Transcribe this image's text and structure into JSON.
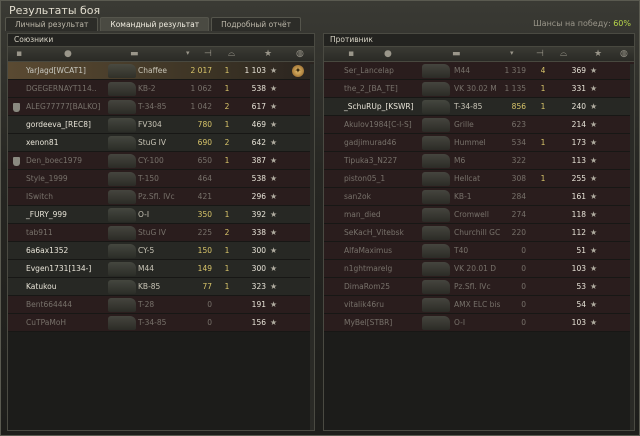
{
  "window": {
    "title": "Результаты боя"
  },
  "tabs": [
    {
      "label": "Личный результат",
      "active": false
    },
    {
      "label": "Командный результат",
      "active": true
    },
    {
      "label": "Подробный отчёт",
      "active": false
    }
  ],
  "chance": {
    "label": "Шансы на победу:",
    "value": "60%"
  },
  "allies": {
    "title": "Союзники",
    "rows": [
      {
        "name": "YarJagd[WCAT1]",
        "tank": "Chaffee",
        "damage": "2 017",
        "kills": "1",
        "xp": "1 103",
        "state": "self",
        "clan": false,
        "medal": true
      },
      {
        "name": "DGEGERNAYT114..",
        "tank": "KB-2",
        "damage": "1 062",
        "kills": "1",
        "xp": "538",
        "state": "dead",
        "clan": false
      },
      {
        "name": "ALEG77777[BALKO]",
        "tank": "T-34-85",
        "damage": "1 042",
        "kills": "2",
        "xp": "617",
        "state": "dead",
        "clan": true
      },
      {
        "name": "gordeeva_[REC8]",
        "tank": "FV304",
        "damage": "780",
        "kills": "1",
        "xp": "469",
        "state": "alive",
        "clan": false
      },
      {
        "name": "xenon81",
        "tank": "StuG IV",
        "damage": "690",
        "kills": "2",
        "xp": "642",
        "state": "alive",
        "clan": false
      },
      {
        "name": "Den_boec1979",
        "tank": "CY-100",
        "damage": "650",
        "kills": "1",
        "xp": "387",
        "state": "dead",
        "clan": true
      },
      {
        "name": "Style_1999",
        "tank": "T-150",
        "damage": "464",
        "kills": "",
        "xp": "538",
        "state": "dead",
        "clan": false
      },
      {
        "name": "ISwitch",
        "tank": "Pz.Sfl. IVc",
        "damage": "421",
        "kills": "",
        "xp": "296",
        "state": "dead",
        "clan": false
      },
      {
        "name": "_FURY_999",
        "tank": "O-I",
        "damage": "350",
        "kills": "1",
        "xp": "392",
        "state": "alive",
        "clan": false
      },
      {
        "name": "tab911",
        "tank": "StuG IV",
        "damage": "225",
        "kills": "2",
        "xp": "338",
        "state": "dead",
        "clan": false
      },
      {
        "name": "6a6ax1352",
        "tank": "CY-5",
        "damage": "150",
        "kills": "1",
        "xp": "300",
        "state": "alive",
        "clan": false
      },
      {
        "name": "Evgen1731[134-]",
        "tank": "M44",
        "damage": "149",
        "kills": "1",
        "xp": "300",
        "state": "alive",
        "clan": false
      },
      {
        "name": "Katukou",
        "tank": "KB-85",
        "damage": "77",
        "kills": "1",
        "xp": "323",
        "state": "alive",
        "clan": false
      },
      {
        "name": "Bent664444",
        "tank": "T-28",
        "damage": "0",
        "kills": "",
        "xp": "191",
        "state": "dead",
        "clan": false
      },
      {
        "name": "CuTPaMoH",
        "tank": "T-34-85",
        "damage": "0",
        "kills": "",
        "xp": "156",
        "state": "dead",
        "clan": false
      }
    ]
  },
  "enemies": {
    "title": "Противник",
    "rows": [
      {
        "name": "Ser_Lancelap",
        "tank": "M44",
        "damage": "1 319",
        "kills": "4",
        "xp": "369",
        "state": "dead"
      },
      {
        "name": "the_2_[BA_TE]",
        "tank": "VK 30.02 M",
        "damage": "1 135",
        "kills": "1",
        "xp": "331",
        "state": "dead"
      },
      {
        "name": "_SchuRUp_[KSWR]",
        "tank": "T-34-85",
        "damage": "856",
        "kills": "1",
        "xp": "240",
        "state": "alive"
      },
      {
        "name": "Akulov1984[C-I-S]",
        "tank": "Grille",
        "damage": "623",
        "kills": "",
        "xp": "214",
        "state": "dead"
      },
      {
        "name": "gadjimurad46",
        "tank": "Hummel",
        "damage": "534",
        "kills": "1",
        "xp": "173",
        "state": "dead"
      },
      {
        "name": "Tipuka3_N227",
        "tank": "M6",
        "damage": "322",
        "kills": "",
        "xp": "113",
        "state": "dead"
      },
      {
        "name": "piston05_1",
        "tank": "Hellcat",
        "damage": "308",
        "kills": "1",
        "xp": "255",
        "state": "dead"
      },
      {
        "name": "san2ok",
        "tank": "KB-1",
        "damage": "284",
        "kills": "",
        "xp": "161",
        "state": "dead"
      },
      {
        "name": "man_died",
        "tank": "Cromwell",
        "damage": "274",
        "kills": "",
        "xp": "118",
        "state": "dead"
      },
      {
        "name": "SeKacH_Vitebsk",
        "tank": "Churchill GC",
        "damage": "220",
        "kills": "",
        "xp": "112",
        "state": "dead"
      },
      {
        "name": "AlfaMaximus",
        "tank": "T40",
        "damage": "0",
        "kills": "",
        "xp": "51",
        "state": "dead"
      },
      {
        "name": "n1ghtmarelg",
        "tank": "VK 20.01 D",
        "damage": "0",
        "kills": "",
        "xp": "103",
        "state": "dead"
      },
      {
        "name": "DimaRom25",
        "tank": "Pz.Sfl. IVc",
        "damage": "0",
        "kills": "",
        "xp": "53",
        "state": "dead"
      },
      {
        "name": "vitalik46ru",
        "tank": "AMX ELC bis",
        "damage": "0",
        "kills": "",
        "xp": "54",
        "state": "dead"
      },
      {
        "name": "MyBel[STBR]",
        "tank": "O-I",
        "damage": "0",
        "kills": "",
        "xp": "103",
        "state": "dead"
      }
    ]
  },
  "icons": {
    "star": "★",
    "medal": "✦"
  }
}
